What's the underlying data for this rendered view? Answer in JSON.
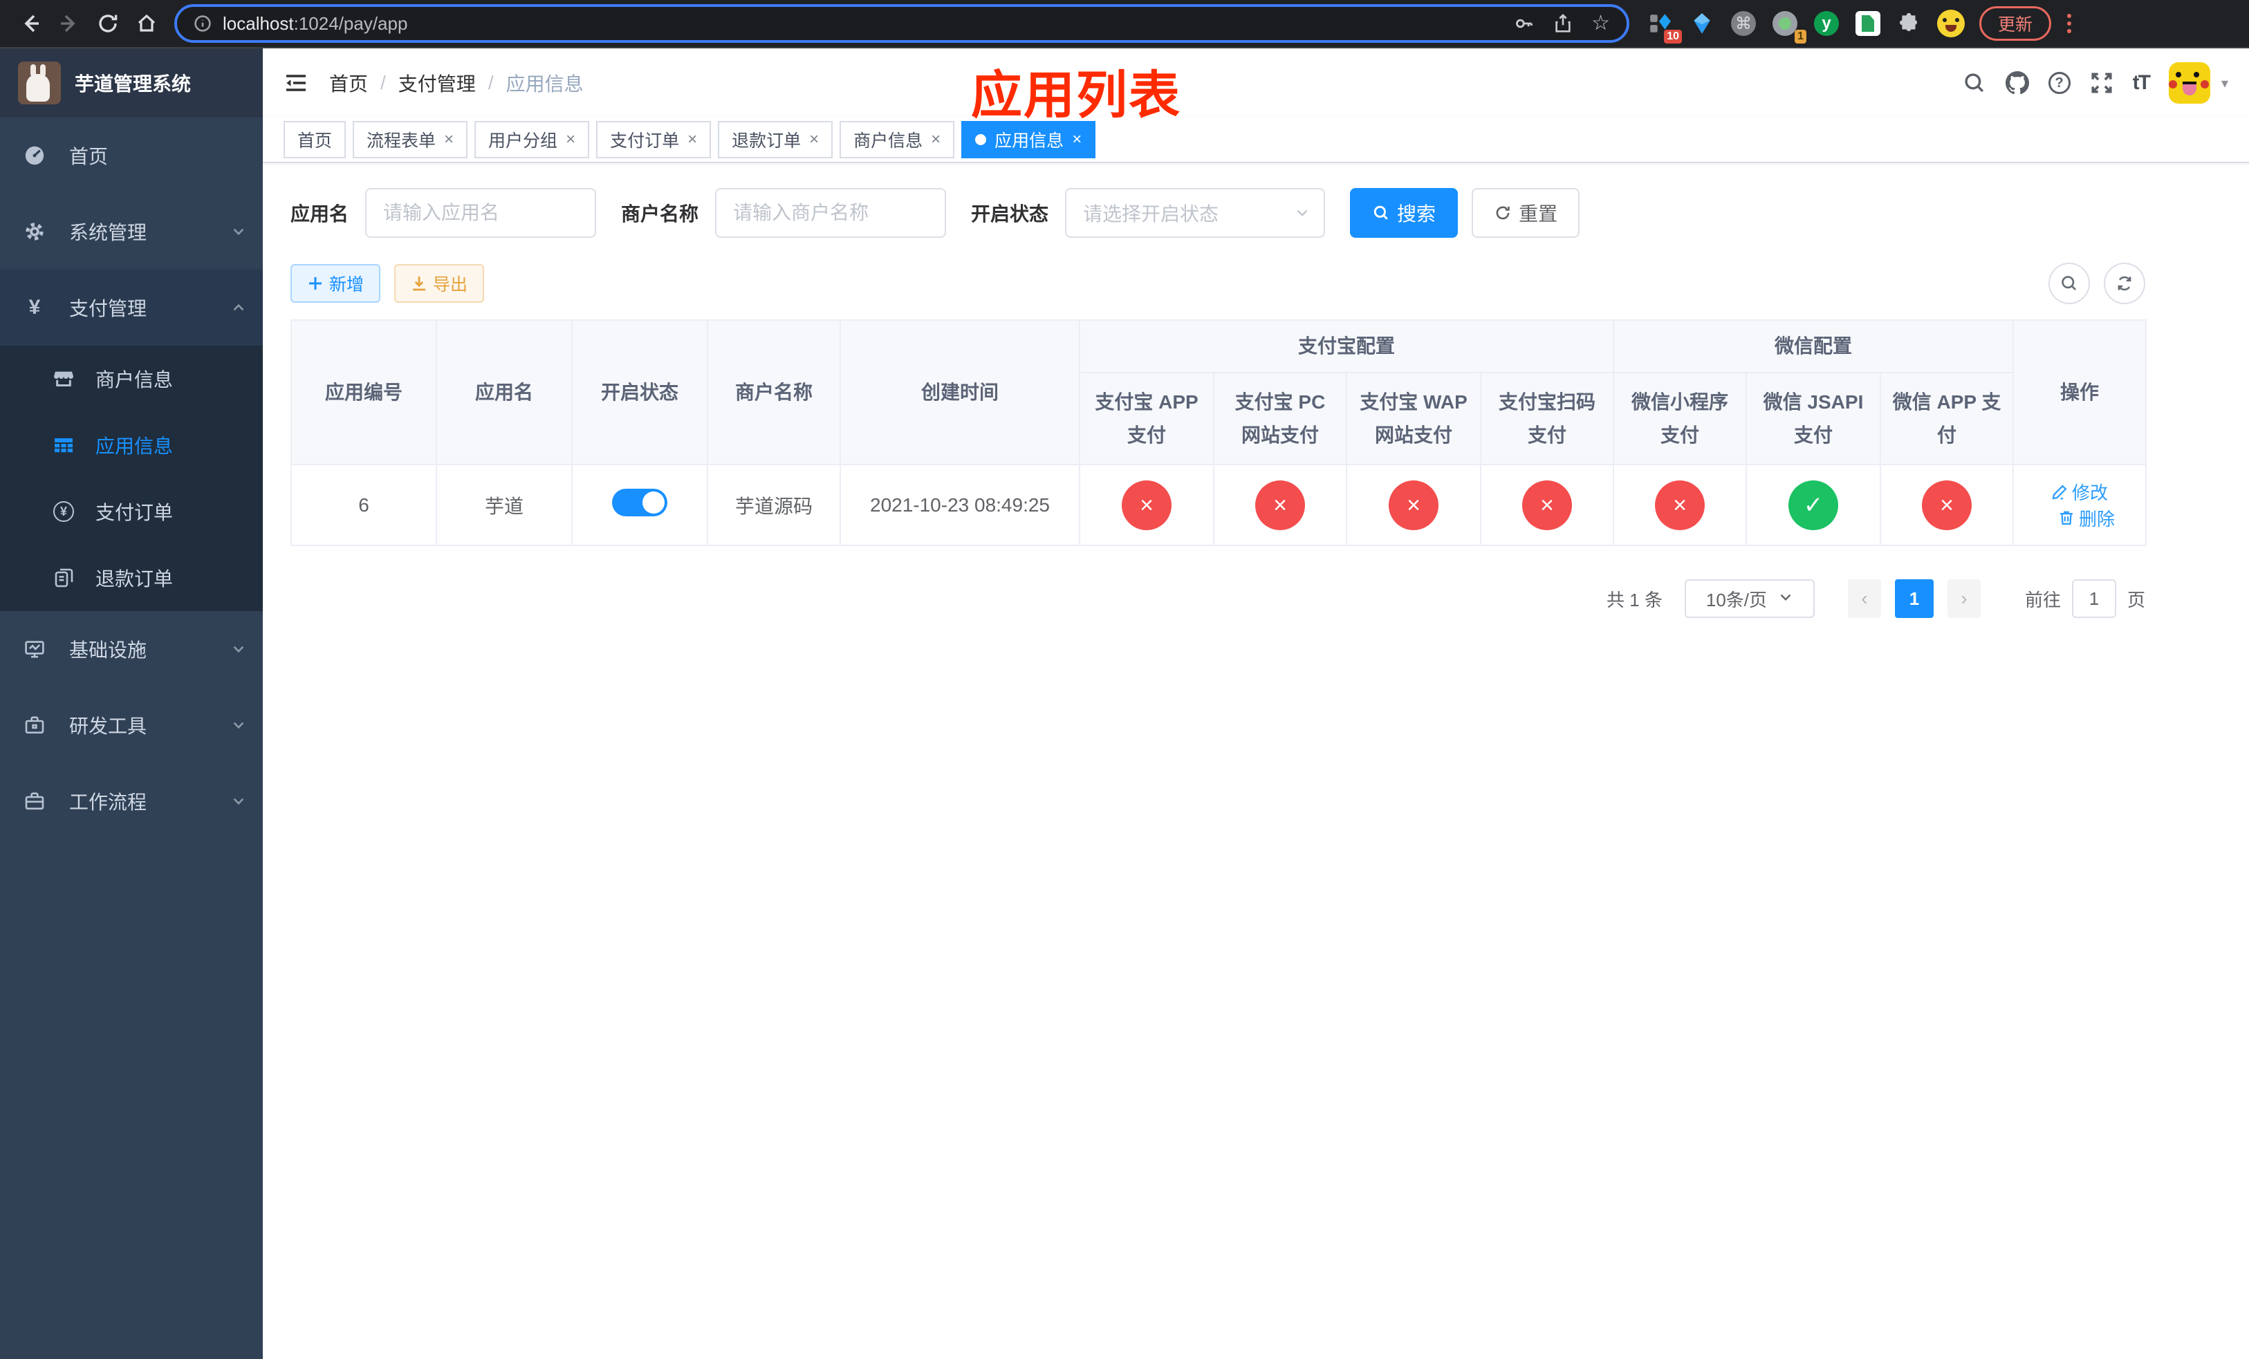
{
  "colors": {
    "primary": "#1890ff",
    "danger": "#f34d4d",
    "success": "#1bc163",
    "overlay_red": "#ff2b00",
    "sidebar_bg": "#304156",
    "submenu_bg": "#1f2d3d"
  },
  "browser": {
    "url_host": "localhost",
    "url_path": ":1024/pay/app",
    "update_label": "更新",
    "ext_badge_blue": "10",
    "ext_badge_session": "1"
  },
  "icons": {
    "close": "×",
    "slash": "/",
    "yen": "¥",
    "star": "☆",
    "question": "?",
    "prev": "‹",
    "next": "›",
    "caret": "▾",
    "command": "⌘",
    "font_size": "tT",
    "letter_y": "y"
  },
  "sidebar": {
    "title": "芋道管理系统",
    "items": [
      {
        "label": "首页"
      },
      {
        "label": "系统管理"
      },
      {
        "label": "支付管理"
      },
      {
        "label": "商户信息"
      },
      {
        "label": "应用信息"
      },
      {
        "label": "支付订单"
      },
      {
        "label": "退款订单"
      },
      {
        "label": "基础设施"
      },
      {
        "label": "研发工具"
      },
      {
        "label": "工作流程"
      }
    ]
  },
  "breadcrumb": {
    "items": [
      "首页",
      "支付管理",
      "应用信息"
    ]
  },
  "overlay_title": "应用列表",
  "tabs": [
    {
      "label": "首页",
      "closable": false,
      "active": false
    },
    {
      "label": "流程表单",
      "closable": true,
      "active": false
    },
    {
      "label": "用户分组",
      "closable": true,
      "active": false
    },
    {
      "label": "支付订单",
      "closable": true,
      "active": false
    },
    {
      "label": "退款订单",
      "closable": true,
      "active": false
    },
    {
      "label": "商户信息",
      "closable": true,
      "active": false
    },
    {
      "label": "应用信息",
      "closable": true,
      "active": true
    }
  ],
  "filters": {
    "app_name_label": "应用名",
    "app_name_placeholder": "请输入应用名",
    "merchant_label": "商户名称",
    "merchant_placeholder": "请输入商户名称",
    "status_label": "开启状态",
    "status_placeholder": "请选择开启状态",
    "search_label": "搜索",
    "reset_label": "重置"
  },
  "toolbar": {
    "add_label": "新增",
    "export_label": "导出"
  },
  "table": {
    "groups": {
      "alipay": "支付宝配置",
      "wechat": "微信配置"
    },
    "cols": {
      "app_id": "应用编号",
      "app_name": "应用名",
      "status": "开启状态",
      "merchant": "商户名称",
      "created": "创建时间",
      "alipay_app": "支付宝 APP 支付",
      "alipay_pc": "支付宝 PC 网站支付",
      "alipay_wap": "支付宝 WAP 网站支付",
      "alipay_qr": "支付宝扫码支付",
      "wx_mini": "微信小程序支付",
      "wx_jsapi": "微信 JSAPI 支付",
      "wx_app": "微信 APP 支付",
      "actions": "操作"
    }
  },
  "row": {
    "app_id": "6",
    "app_name": "芋道",
    "status_on": true,
    "merchant": "芋道源码",
    "created": "2021-10-23 08:49:25",
    "configs": [
      {
        "name": "alipay-app",
        "cls": "status-circle fail",
        "glyph": "×"
      },
      {
        "name": "alipay-pc",
        "cls": "status-circle fail",
        "glyph": "×"
      },
      {
        "name": "alipay-wap",
        "cls": "status-circle fail",
        "glyph": "×"
      },
      {
        "name": "alipay-qr",
        "cls": "status-circle fail",
        "glyph": "×"
      },
      {
        "name": "wx-mini",
        "cls": "status-circle fail",
        "glyph": "×"
      },
      {
        "name": "wx-jsapi",
        "cls": "status-circle success",
        "glyph": "✓"
      },
      {
        "name": "wx-app",
        "cls": "status-circle fail",
        "glyph": "×"
      }
    ],
    "edit_label": "修改",
    "delete_label": "删除"
  },
  "pagination": {
    "total": "共 1 条",
    "page_size": "10条/页",
    "current_page": "1",
    "goto_label": "前往",
    "goto_value": "1",
    "page_unit": "页"
  }
}
